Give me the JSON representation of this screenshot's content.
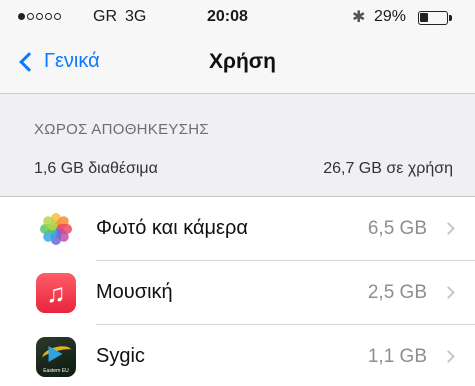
{
  "status_bar": {
    "carrier": "GR",
    "network": "3G",
    "time": "20:08",
    "bluetooth_icon": "bluetooth-icon",
    "battery_percent": "29%",
    "battery_level": 0.29,
    "signal_bars_filled": 1,
    "signal_bars_total": 5
  },
  "nav": {
    "back_label": "Γενικά",
    "title": "Χρήση",
    "accent_color": "#0a7bff"
  },
  "storage": {
    "header": "ΧΩΡΟΣ ΑΠΟΘΗΚΕΥΣΗΣ",
    "available": "1,6 GB διαθέσιμα",
    "used": "26,7 GB σε χρήση"
  },
  "apps": [
    {
      "name": "Φωτό και κάμερα",
      "size": "6,5 GB",
      "icon": "photos-icon"
    },
    {
      "name": "Μουσική",
      "size": "2,5 GB",
      "icon": "music-icon"
    },
    {
      "name": "Sygic",
      "size": "1,1 GB",
      "icon": "sygic-icon",
      "icon_caption": "Eastern EU"
    }
  ]
}
